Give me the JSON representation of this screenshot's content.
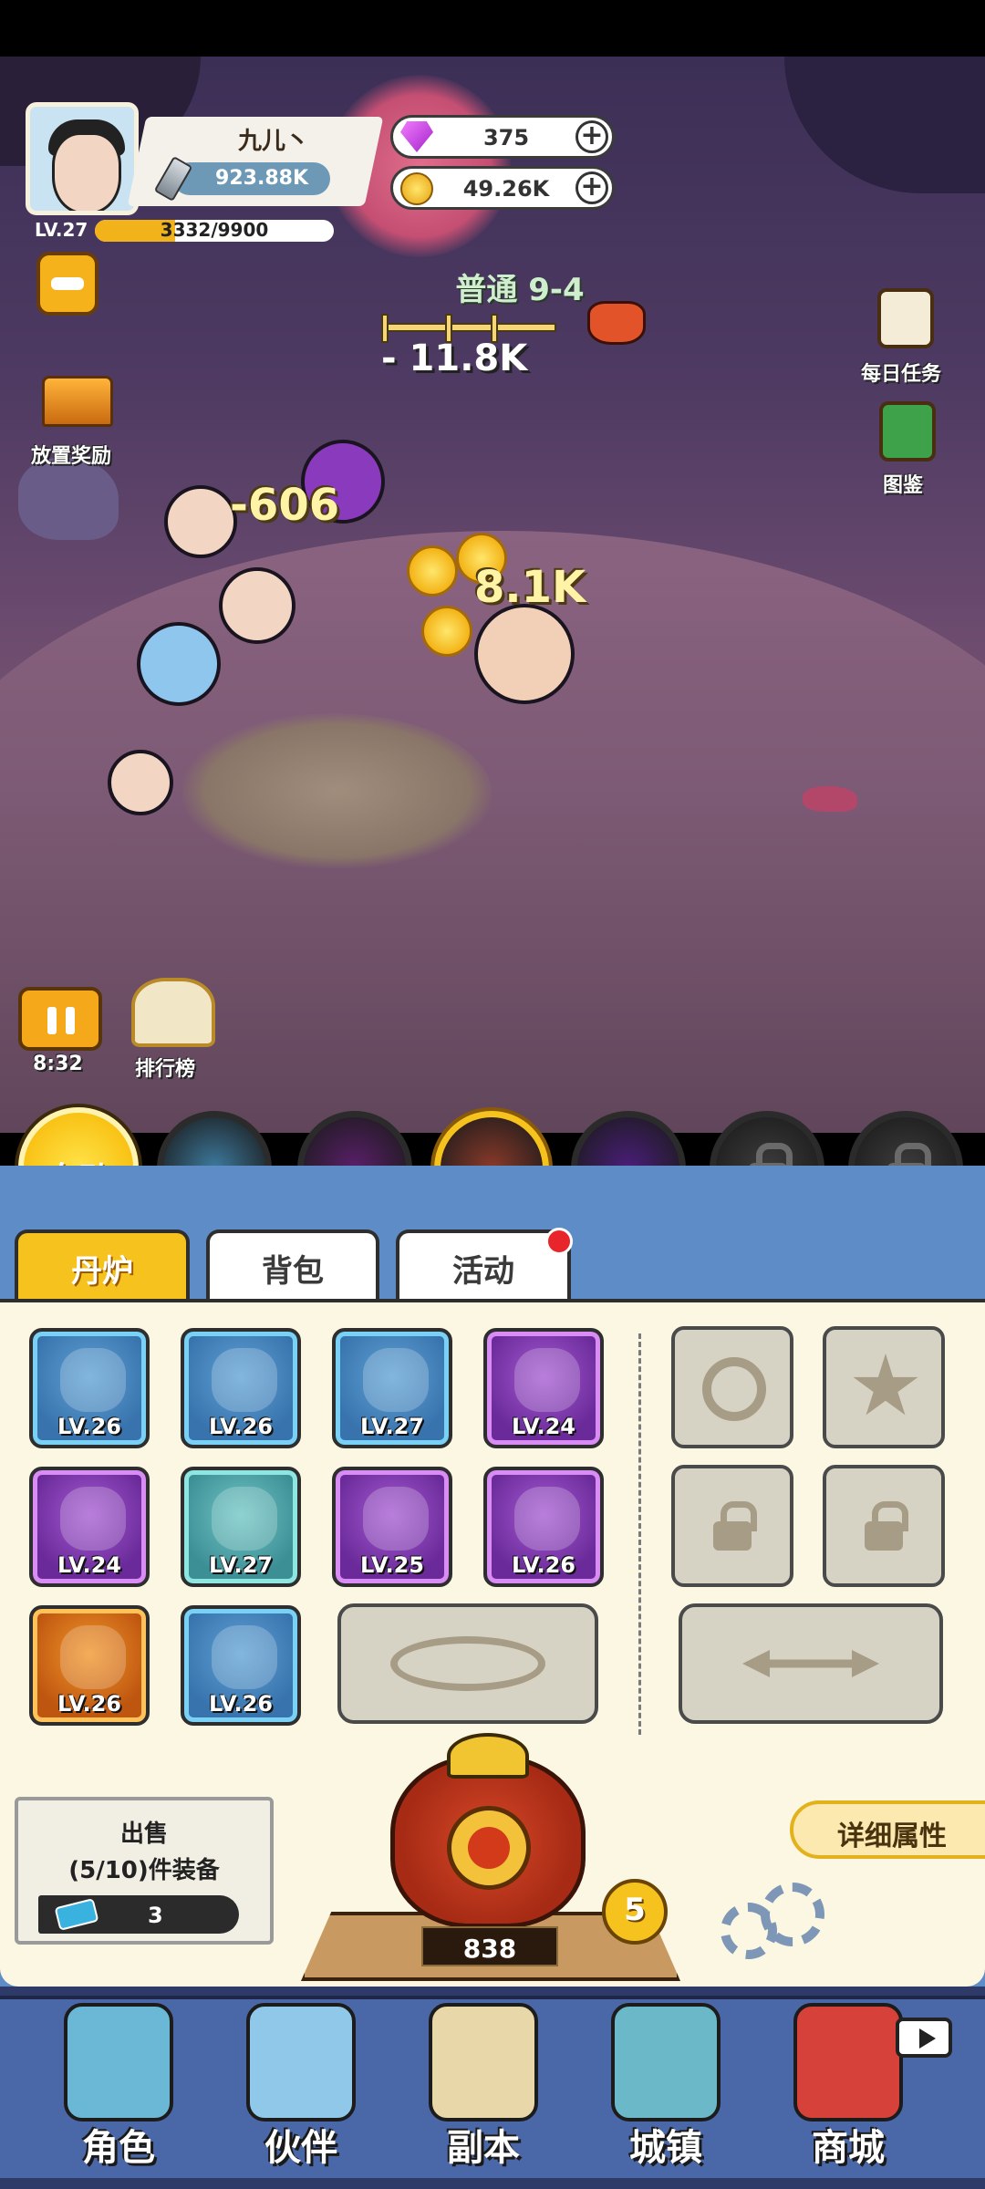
{
  "player": {
    "name": "九儿丶",
    "combat_power": "923.88K",
    "level": "LV.27",
    "exp_text": "3332/9900",
    "exp_fraction": 0.3366
  },
  "resources": {
    "gems": "375",
    "gold": "49.26K",
    "plus_label": "+"
  },
  "stage": {
    "name": "普通 9-4",
    "damage": "- 11.8K",
    "progress_fraction": 0.5
  },
  "left_actions": {
    "idle_reward_label": "放置奖励",
    "timer": "8:32",
    "leaderboard_label": "排行榜"
  },
  "right_actions": {
    "daily_task_label": "每日任务",
    "codex_label": "图鉴"
  },
  "battle_popups": [
    "-606",
    "8.1K"
  ],
  "skills": {
    "auto_label": "自动",
    "slots": [
      {
        "name": "unicorn-skill-icon",
        "color": "#3d7a9e"
      },
      {
        "name": "lightning-skill-icon",
        "color": "#5a1f6a"
      },
      {
        "name": "beast-skill-icon",
        "color": "#8a3a2a",
        "active": true
      },
      {
        "name": "vortex-skill-icon",
        "color": "#4a1e7a"
      },
      {
        "name": "locked-skill-icon",
        "color": "#3c3c3c"
      },
      {
        "name": "locked-skill-icon",
        "color": "#3c3c3c"
      }
    ]
  },
  "tabs": [
    {
      "label": "丹炉",
      "active": true
    },
    {
      "label": "背包",
      "active": false
    },
    {
      "label": "活动",
      "active": false,
      "badge": true
    }
  ],
  "inventory": [
    {
      "level": "LV.26",
      "rarity": "blue",
      "icon": "spear-icon"
    },
    {
      "level": "LV.26",
      "rarity": "blue",
      "icon": "helmet-icon"
    },
    {
      "level": "LV.27",
      "rarity": "blue",
      "icon": "robe-icon"
    },
    {
      "level": "LV.24",
      "rarity": "purple",
      "icon": "demon-orb-icon"
    },
    {
      "level": "LV.24",
      "rarity": "purple",
      "icon": "blade-icon"
    },
    {
      "level": "LV.27",
      "rarity": "teal",
      "icon": "jade-disc-icon"
    },
    {
      "level": "LV.25",
      "rarity": "purple",
      "icon": "gourd-icon"
    },
    {
      "level": "LV.26",
      "rarity": "purple",
      "icon": "fire-pearl-icon"
    },
    {
      "level": "LV.26",
      "rarity": "orange",
      "icon": "amulet-icon"
    },
    {
      "level": "LV.26",
      "rarity": "blue",
      "icon": "boots-icon"
    }
  ],
  "sell": {
    "title": "出售",
    "subtitle": "(5/10)件装备",
    "cost": "3"
  },
  "furnace": {
    "count": "838",
    "level": "5",
    "details_label": "详细属性"
  },
  "nav": [
    {
      "label": "角色",
      "icon": "character-icon",
      "color": "#6bb8d6"
    },
    {
      "label": "伙伴",
      "icon": "partner-icon",
      "color": "#8fc8e8"
    },
    {
      "label": "副本",
      "icon": "dungeon-scroll-icon",
      "color": "#e8d7a8"
    },
    {
      "label": "城镇",
      "icon": "town-icon",
      "color": "#6bb8c8"
    },
    {
      "label": "商城",
      "icon": "shop-icon",
      "color": "#d6423a"
    }
  ],
  "colors": {
    "accent_gold": "#f6c21d",
    "panel_blue": "#5e8cc6",
    "panel_cream": "#fbf7e2"
  }
}
